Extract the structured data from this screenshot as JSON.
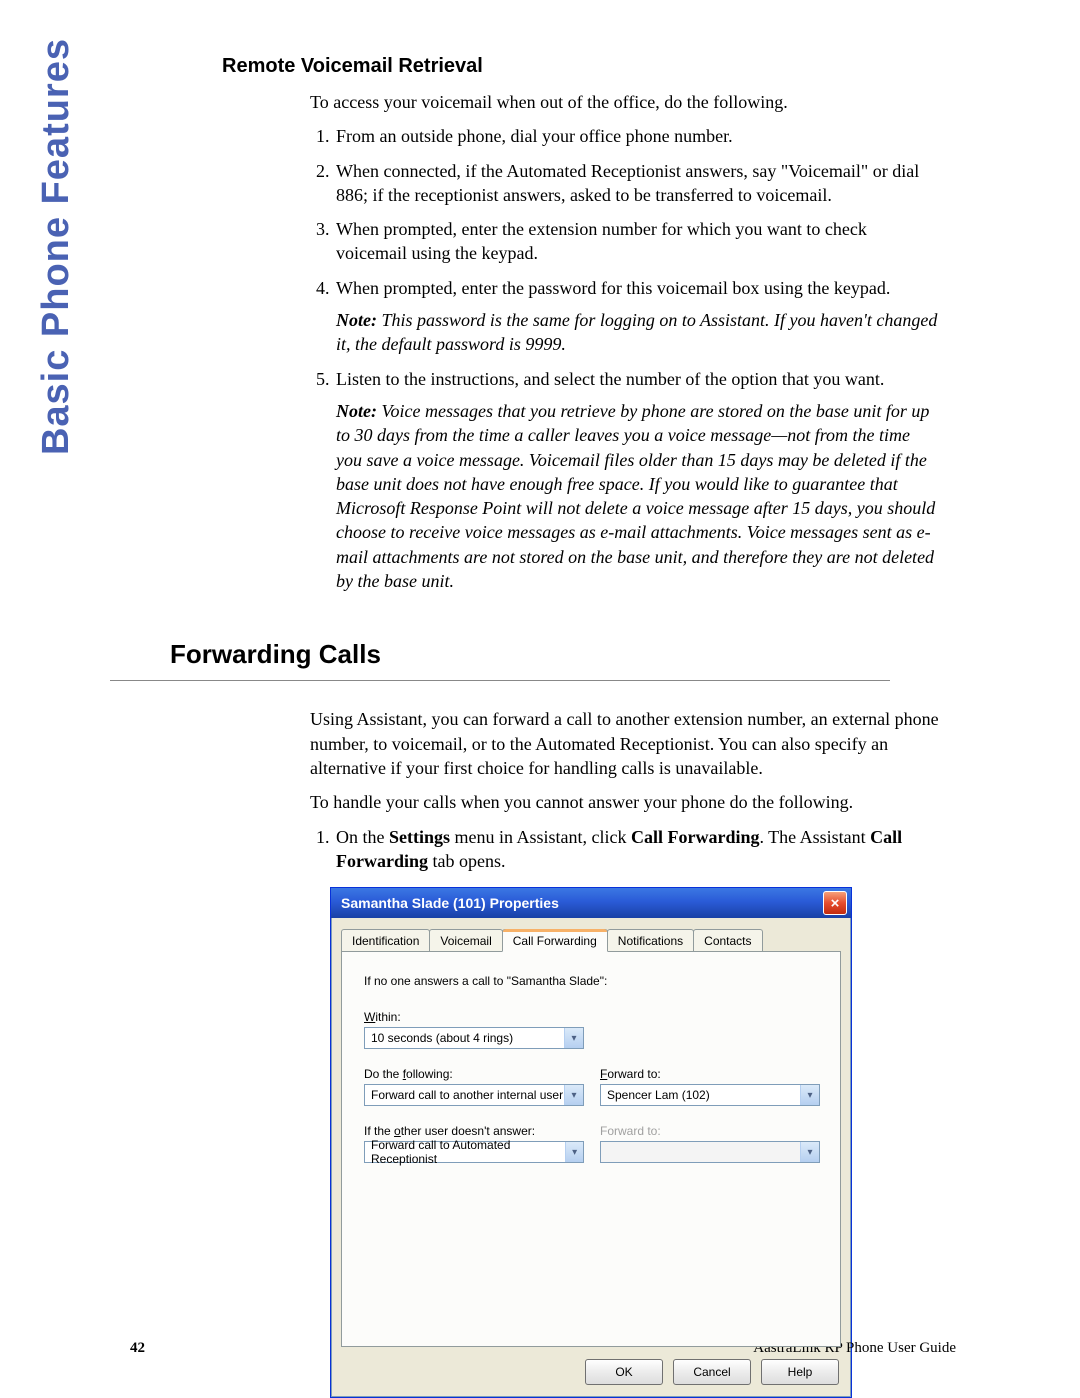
{
  "sidebar": {
    "title": "Basic Phone Features"
  },
  "sections": {
    "remoteVoicemail": {
      "heading": "Remote Voicemail Retrieval",
      "intro": "To access your voicemail when out of the office, do the following.",
      "steps": {
        "s1": "From an outside phone, dial your office phone number.",
        "s2": "When connected, if the Automated Receptionist answers, say \"Voicemail\" or dial 886; if the receptionist answers, asked to be transferred to voicemail.",
        "s3": "When prompted, enter the extension number for which you want to check voicemail using the keypad.",
        "s4": "When prompted, enter the password for this voicemail box using the keypad.",
        "note4_lead": "Note:",
        "note4": " This password is the same for logging on to Assistant. If you haven't changed it, the default password is 9999.",
        "s5": "Listen to the instructions, and select the number of the option that you want.",
        "note5_lead": "Note:",
        "note5": " Voice messages that you retrieve by phone are stored on the base unit for up to 30 days from the time a caller leaves you a voice message—not from the time you save a voice message. Voicemail files older than 15 days may be deleted if the base unit does not have enough free space. If you would like to guarantee that Microsoft Response Point will not delete a voice message after 15 days, you should choose to receive voice messages as e-mail attachments. Voice messages sent as e-mail attachments are not stored on the base unit, and therefore they are not deleted by the base unit."
      }
    },
    "forwarding": {
      "heading": "Forwarding Calls",
      "p1": "Using Assistant, you can forward a call to another extension number, an external phone number, to voicemail, or to the Automated Receptionist. You can also specify an alternative if your first choice for handling calls is unavailable.",
      "p2": "To handle your calls when you cannot answer your phone do the following.",
      "step1_a": "On the ",
      "step1_b": "Settings",
      "step1_c": " menu in Assistant, click ",
      "step1_d": "Call Forwarding",
      "step1_e": ". The Assistant ",
      "step1_f": "Call Forwarding",
      "step1_g": " tab opens."
    }
  },
  "dialog": {
    "title": "Samantha Slade (101) Properties",
    "close_glyph": "×",
    "tabs": {
      "identification": "Identification",
      "voicemail": "Voicemail",
      "callforwarding": "Call Forwarding",
      "notifications": "Notifications",
      "contacts": "Contacts"
    },
    "panel": {
      "prompt": "If no one answers a call to \"Samantha Slade\":",
      "within_label_pre": "W",
      "within_label_post": "ithin:",
      "within_value": "10 seconds (about 4 rings)",
      "do_label_pre": "Do the ",
      "do_label_u": "f",
      "do_label_post": "ollowing:",
      "do_value": "Forward call to another internal user",
      "fwd1_label_u": "F",
      "fwd1_label_post": "orward to:",
      "fwd1_value": "Spencer Lam (102)",
      "other_label_pre": "If the ",
      "other_label_u": "o",
      "other_label_post": "ther user doesn't answer:",
      "other_value": "Forward call to Automated Receptionist",
      "fwd2_label": "Forward to:"
    },
    "buttons": {
      "ok": "OK",
      "cancel": "Cancel",
      "help": "Help"
    }
  },
  "footer": {
    "page": "42",
    "guide": "AastraLink RP Phone User Guide"
  }
}
